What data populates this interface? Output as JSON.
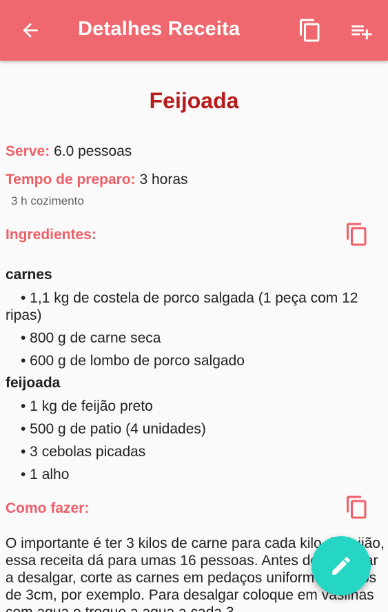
{
  "appbar": {
    "title": "Detalhes Receita",
    "icons": {
      "back": "arrow-back-icon",
      "copy": "content-copy-icon",
      "add": "playlist-add-icon"
    }
  },
  "recipe": {
    "title": "Feijoada",
    "serves_label": "Serve:",
    "serves_value": "6.0 pessoas",
    "prep_label": "Tempo de preparo:",
    "prep_value": "3 horas",
    "prep_note": "3 h cozimento"
  },
  "ingredients": {
    "label": "Ingredientes:",
    "groups": [
      {
        "title": "carnes",
        "items": [
          "• 1,1 kg de costela de porco salgada (1 peça com 12 ripas)",
          "• 800 g de carne seca",
          "• 600 g de lombo de porco salgado"
        ]
      },
      {
        "title": "feijoada",
        "items": [
          "• 1 kg de feijão preto",
          "• 500 g de patio (4 unidades)",
          "• 3 cebolas picadas",
          "• 1 alho"
        ]
      }
    ]
  },
  "method": {
    "label": "Como fazer:",
    "text": "O importante é ter 3 kilos de carne para cada kilo de feijão, essa receita dá para umas 16 pessoas. Antes de começar a desalgar, corte as carnes em pedaços uniformes, cubos de 3cm, por exemplo. Para desalgar coloque em vasilhas com agua e troque a agua a cada 3"
  },
  "fab": {
    "icon": "edit-pencil-icon"
  },
  "colors": {
    "appbar": "#f0686f",
    "title": "#b71c1c",
    "label": "#ef5f68",
    "fab": "#26d6c4"
  }
}
